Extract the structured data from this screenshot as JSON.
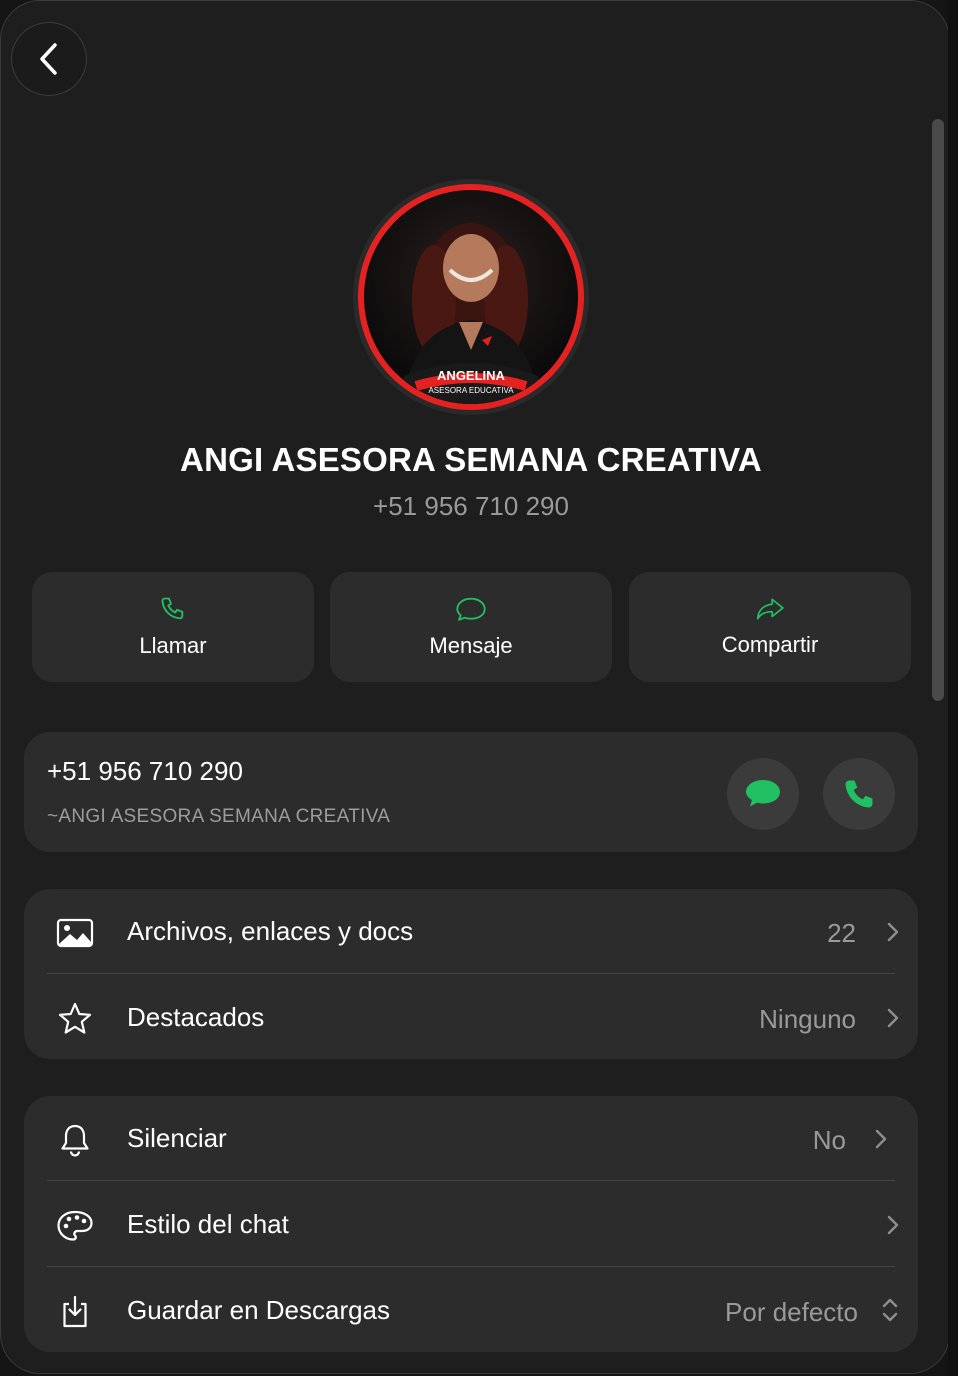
{
  "header": {
    "back_label": "Back"
  },
  "profile": {
    "name": "ANGI ASESORA SEMANA CREATIVA",
    "phone": "+51 956 710 290",
    "badge_name": "ANGELINA",
    "badge_role": "ASESORA EDUCATIVA"
  },
  "actions": [
    {
      "label": "Llamar",
      "icon": "phone-icon"
    },
    {
      "label": "Mensaje",
      "icon": "message-icon"
    },
    {
      "label": "Compartir",
      "icon": "share-icon"
    }
  ],
  "phone_card": {
    "number": "+51 956 710 290",
    "label": "~ANGI ASESORA SEMANA CREATIVA"
  },
  "media_section": {
    "rows": [
      {
        "label": "Archivos, enlaces y docs",
        "value": "22",
        "icon": "image-icon"
      },
      {
        "label": "Destacados",
        "value": "Ninguno",
        "icon": "star-icon"
      }
    ]
  },
  "settings_section": {
    "rows": [
      {
        "label": "Silenciar",
        "value": "No",
        "icon": "bell-icon"
      },
      {
        "label": "Estilo del chat",
        "value": "",
        "icon": "palette-icon"
      },
      {
        "label": "Guardar en Descargas",
        "value": "Por defecto",
        "icon": "download-icon"
      }
    ]
  },
  "colors": {
    "accent_green": "#21c063",
    "avatar_ring": "#e52222",
    "background": "#1e1e1e",
    "card": "#2c2c2c"
  }
}
